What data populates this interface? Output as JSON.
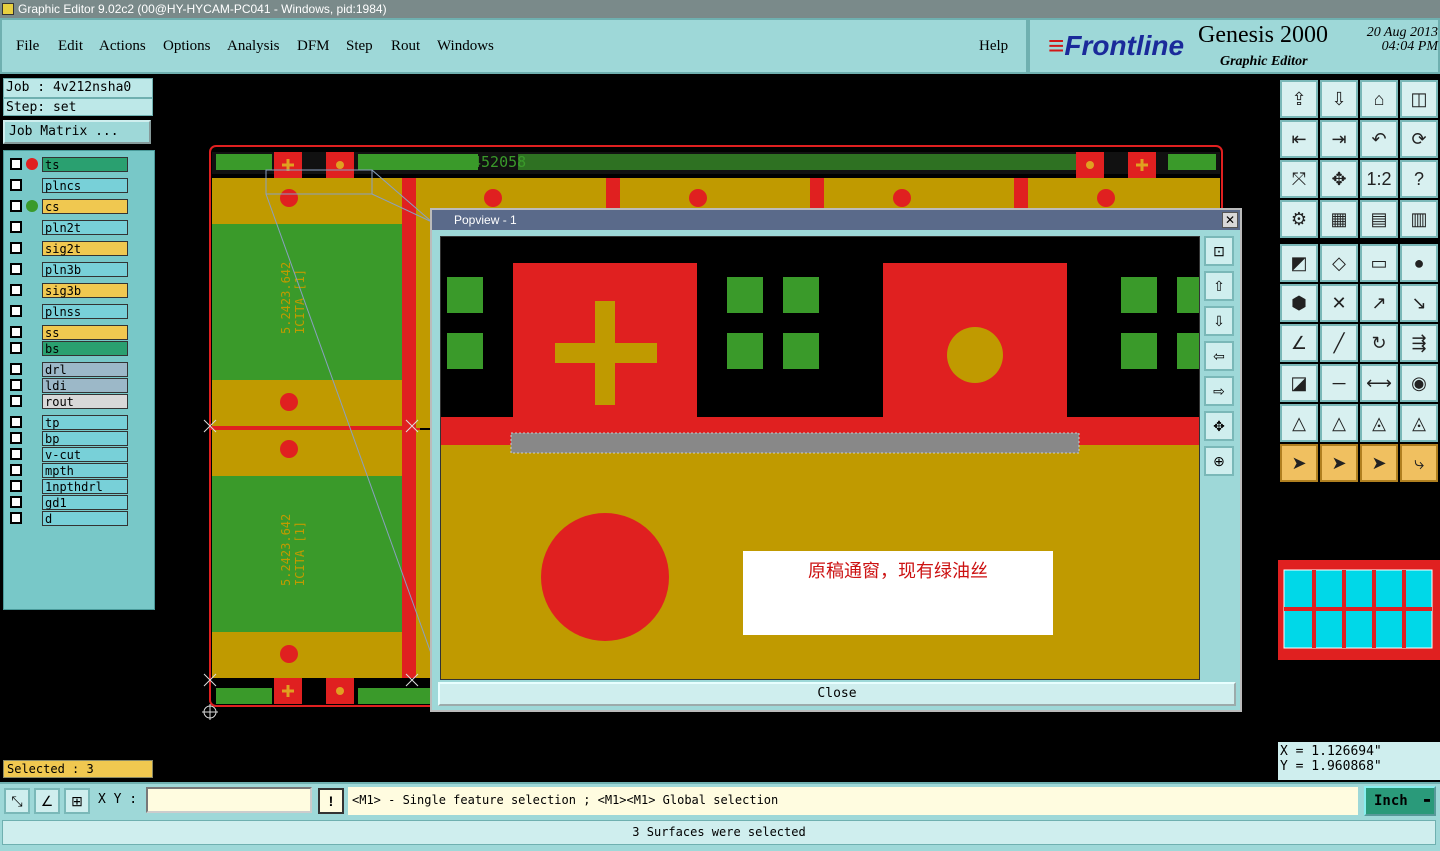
{
  "window": {
    "title": "Graphic Editor 9.02c2 (00@HY-HYCAM-PC041 - Windows, pid:1984)"
  },
  "menu": {
    "items": [
      "File",
      "Edit",
      "Actions",
      "Options",
      "Analysis",
      "DFM",
      "Step",
      "Rout",
      "Windows"
    ],
    "help": "Help"
  },
  "brand": {
    "logo": "Frontline",
    "product": "Genesis 2000",
    "subtitle": "Graphic Editor",
    "date": "20 Aug 2013",
    "time": "04:04 PM"
  },
  "job": {
    "job_label": "Job : 4v212nsha0",
    "step_label": "Step: set",
    "matrix_button": "Job Matrix ..."
  },
  "layers": [
    {
      "name": "ts",
      "color": "#2aa070"
    },
    {
      "name": "plncs",
      "color": "#78d0d8"
    },
    {
      "name": "cs",
      "color": "#f0c850"
    },
    {
      "name": "pln2t",
      "color": "#78d0d8"
    },
    {
      "name": "sig2t",
      "color": "#f0c850"
    },
    {
      "name": "pln3b",
      "color": "#78d0d8"
    },
    {
      "name": "sig3b",
      "color": "#f0c850"
    },
    {
      "name": "plnss",
      "color": "#78d0d8"
    },
    {
      "name": "ss",
      "color": "#f0c850"
    },
    {
      "name": "bs",
      "color": "#2aa070"
    },
    {
      "name": "drl",
      "color": "#9cb8c8"
    },
    {
      "name": "ldi",
      "color": "#9cb8c8"
    },
    {
      "name": "rout",
      "color": "#d8d8d8"
    },
    {
      "name": "tp",
      "color": "#78d0d8"
    },
    {
      "name": "bp",
      "color": "#78d0d8"
    },
    {
      "name": "v-cut",
      "color": "#78d0d8"
    },
    {
      "name": "mpth",
      "color": "#78d0d8"
    },
    {
      "name": "1npthdrl",
      "color": "#78d0d8"
    },
    {
      "name": "gd1",
      "color": "#78d0d8"
    },
    {
      "name": "d",
      "color": "#78d0d8"
    }
  ],
  "selected_count": "Selected : 3",
  "board": {
    "label": "452058",
    "module_text_1": "5.2423.642",
    "module_text_2": "ICITA [1]"
  },
  "popup": {
    "title": "Popview - 1",
    "close_x": "✕",
    "close_button": "Close",
    "note": "原稿通窗，现有绿油丝"
  },
  "coords": {
    "x": "X =  1.126694\"",
    "y": "Y =  1.960868\""
  },
  "bottom": {
    "xy_label": "X Y :",
    "xy_value": "",
    "bang": "!",
    "hint": "<M1> - Single feature selection ; <M1><M1> Global selection",
    "units": "Inch"
  },
  "status": "3 Surfaces were selected"
}
